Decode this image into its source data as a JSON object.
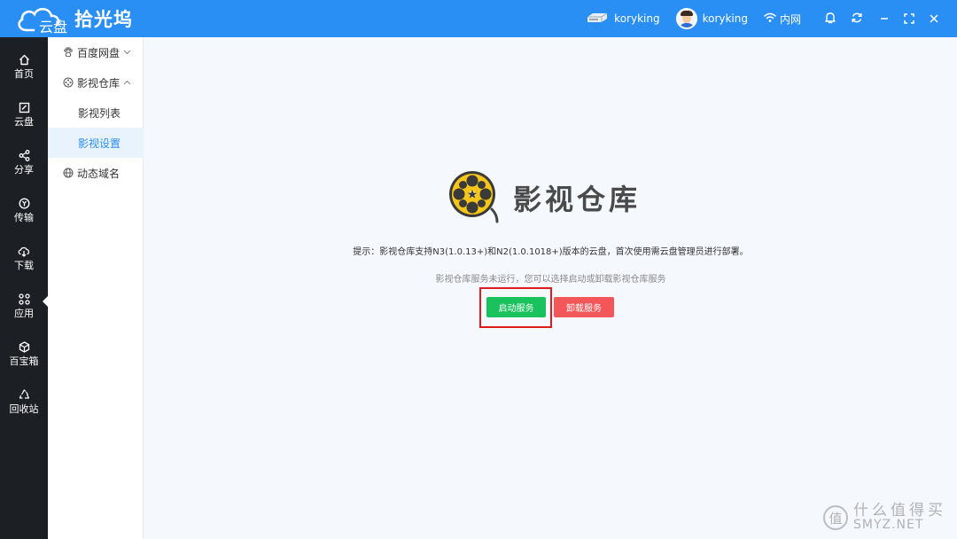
{
  "app": {
    "cloud_label": "云盘",
    "brand_name": "拾光坞"
  },
  "titlebar": {
    "device_name": "koryking",
    "user_name": "koryking",
    "network_label": "内网"
  },
  "left_nav": {
    "items": [
      {
        "label": "首页",
        "icon": "home-icon"
      },
      {
        "label": "云盘",
        "icon": "cloud-drive-icon"
      },
      {
        "label": "分享",
        "icon": "share-icon"
      },
      {
        "label": "传输",
        "icon": "transfer-icon"
      },
      {
        "label": "下载",
        "icon": "download-icon"
      },
      {
        "label": "应用",
        "icon": "apps-icon"
      },
      {
        "label": "百宝箱",
        "icon": "toolbox-icon"
      },
      {
        "label": "回收站",
        "icon": "recycle-icon"
      }
    ],
    "active": "应用"
  },
  "sub_nav": {
    "items": [
      {
        "label": "百度网盘",
        "icon": "baidu-paw-icon",
        "expanded": false
      },
      {
        "label": "影视仓库",
        "icon": "film-reel-icon",
        "expanded": true
      },
      {
        "label": "影视列表"
      },
      {
        "label": "影视设置",
        "active": true
      },
      {
        "label": "动态域名",
        "icon": "globe-icon"
      }
    ]
  },
  "main": {
    "hero_title": "影视仓库",
    "notice": "提示：影视仓库支持N3(1.0.13+)和N2(1.0.1018+)版本的云盘，首次使用需云盘管理员进行部署。",
    "status": "影视仓库服务未运行，您可以选择启动或卸载影视仓库服务",
    "start_button": "启动服务",
    "uninstall_button": "卸载服务"
  },
  "watermark": {
    "badge": "值",
    "cn": "什么值得买",
    "en": "SMYZ.NET"
  },
  "colors": {
    "titlebar": "#2a8ff5",
    "left_nav": "#1c1f24",
    "start": "#19c25c",
    "uninstall": "#f4575a",
    "highlight": "#e01d1d"
  }
}
